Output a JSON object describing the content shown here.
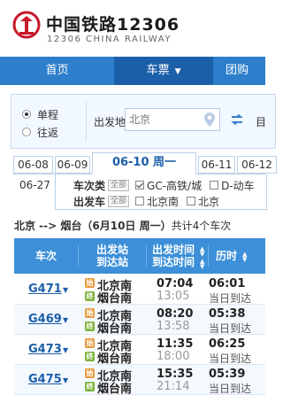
{
  "header": {
    "title_cn": "中国铁路12306",
    "title_en": "12306 CHINA RAILWAY",
    "brand_color": "#c8182a"
  },
  "nav": {
    "home": "首页",
    "tickets": "车票",
    "group": "团购",
    "accent": "#2e7fcb"
  },
  "search": {
    "one_way": "单程",
    "round_trip": "往返",
    "from_label": "出发地",
    "from_value": "北京",
    "to_label": "目"
  },
  "dates": {
    "tabs": [
      "06-08",
      "06-09",
      "06-10 周一",
      "06-11",
      "06-12"
    ],
    "active_index": 2,
    "left_label": "06-27"
  },
  "filters": {
    "train_type_label": "车次类",
    "depart_station_label": "出发车",
    "all_label": "全部",
    "train_types": [
      {
        "label": "GC-高铁/城",
        "checked": true
      },
      {
        "label": "D-动车",
        "checked": false
      }
    ],
    "stations": [
      {
        "label": "北京南",
        "checked": false
      },
      {
        "label": "北京",
        "checked": false
      }
    ]
  },
  "summary": {
    "route": "北京 --> 烟台",
    "date": "（6月10日  周一）",
    "count": "共计4个车次"
  },
  "table": {
    "headers": {
      "train": "车次",
      "stations_1": "出发站",
      "stations_2": "到达站",
      "times_1": "出发时间",
      "times_2": "到达时间",
      "duration": "历时"
    },
    "start_badge": "始",
    "end_badge": "终",
    "rows": [
      {
        "train": "G471",
        "from": "北京南",
        "to": "烟台南",
        "depart": "07:04",
        "arrive": "13:05",
        "duration": "06:01",
        "day": "当日到达"
      },
      {
        "train": "G469",
        "from": "北京南",
        "to": "烟台南",
        "depart": "08:20",
        "arrive": "13:58",
        "duration": "05:38",
        "day": "当日到达"
      },
      {
        "train": "G473",
        "from": "北京南",
        "to": "烟台南",
        "depart": "11:35",
        "arrive": "18:00",
        "duration": "06:25",
        "day": "当日到达"
      },
      {
        "train": "G475",
        "from": "北京南",
        "to": "烟台南",
        "depart": "15:35",
        "arrive": "21:14",
        "duration": "05:39",
        "day": "当日到达"
      }
    ]
  }
}
